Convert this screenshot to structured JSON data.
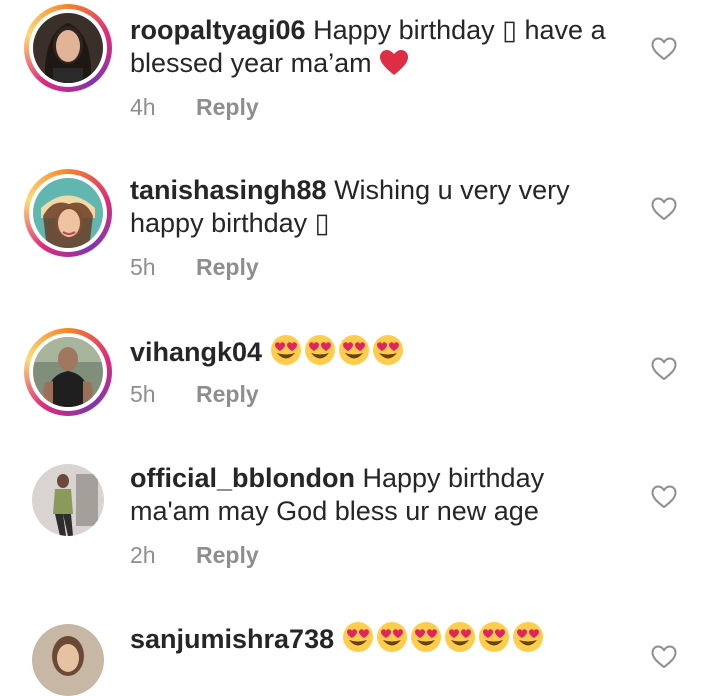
{
  "comments": [
    {
      "username": "roopaltyagi06",
      "text": " Happy birthday ▯ have a blessed year ma’am ",
      "time": "4h",
      "reply": "Reply",
      "emoji": "red-heart"
    },
    {
      "username": "tanishasingh88",
      "text": " Wishing u very very happy birthday ▯",
      "time": "5h",
      "reply": "Reply"
    },
    {
      "username": "vihangk04",
      "text": " ",
      "time": "5h",
      "reply": "Reply",
      "emoji": "heart-eyes",
      "emoji_count": 4
    },
    {
      "username": "official_bblondon",
      "text": " Happy birthday ma'am may God bless ur new age",
      "time": "2h",
      "reply": "Reply"
    },
    {
      "username": "sanjumishra738",
      "text": " ",
      "emoji": "heart-eyes",
      "emoji_count": 6
    }
  ],
  "icons": {
    "like": "heart-outline-icon",
    "story_ring_colors": [
      "#f58529",
      "#dd2a7b",
      "#8134af",
      "#feda77"
    ]
  }
}
